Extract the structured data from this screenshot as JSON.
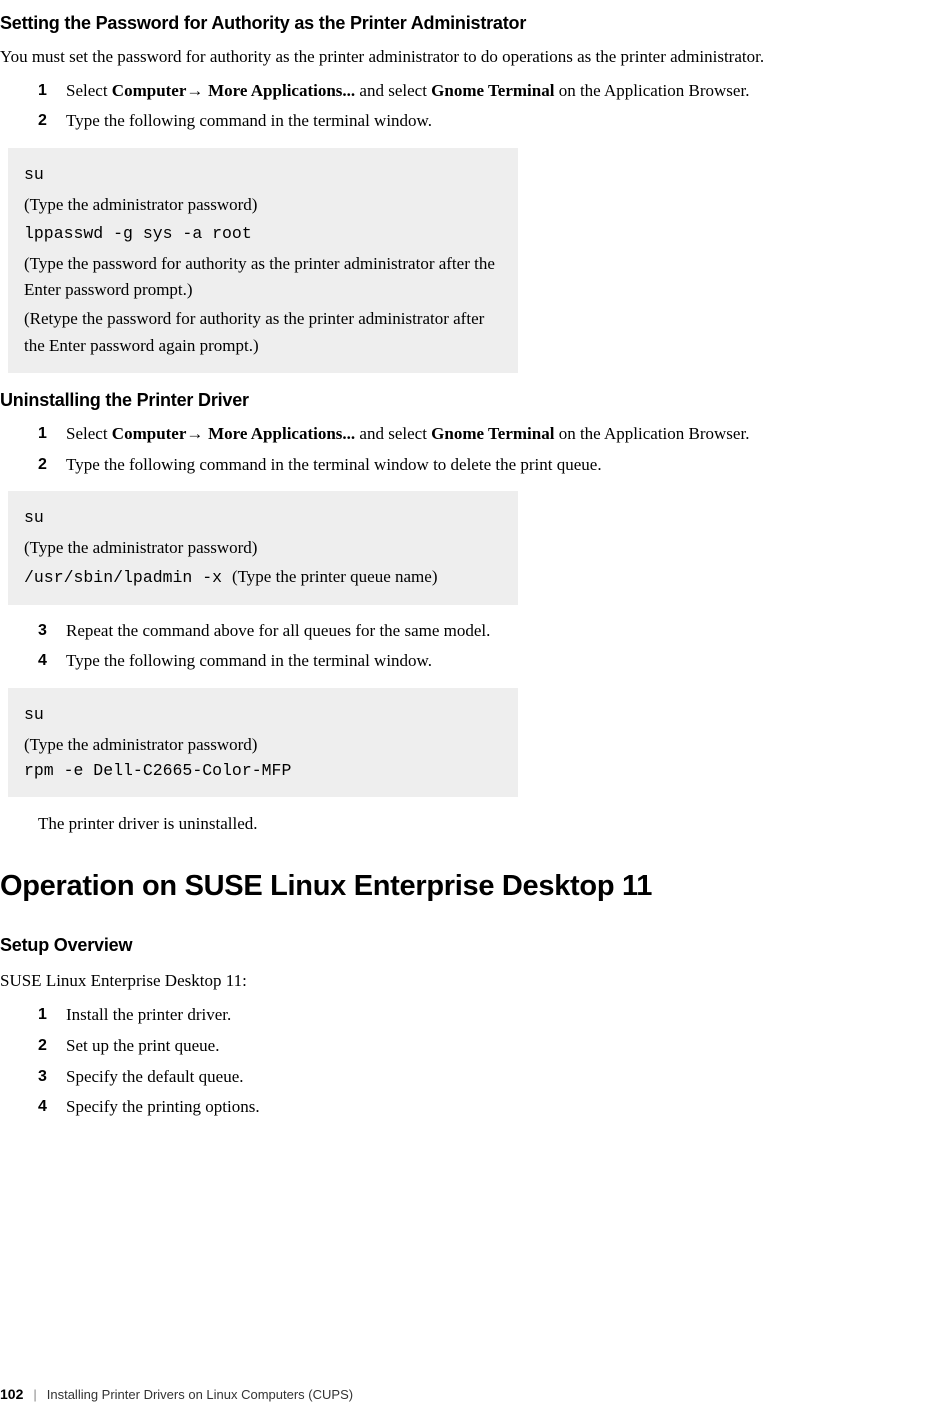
{
  "section1": {
    "title": "Setting the Password for Authority as the Printer Administrator",
    "intro": "You must set the password for authority as the printer administrator to do operations as the printer administrator.",
    "step1_num": "1",
    "step1_a": "Select ",
    "step1_b": "Computer",
    "step1_arrow": "→ ",
    "step1_c": "More Applications...",
    "step1_d": " and select ",
    "step1_e": "Gnome Terminal",
    "step1_f": " on the Application Browser.",
    "step2_num": "2",
    "step2": "Type the following command in the terminal window."
  },
  "codebox1": {
    "l1": "su",
    "l2": "(Type the administrator password)",
    "l3": "lppasswd -g sys -a root",
    "l4": "(Type the password for authority as the printer administrator after the Enter password prompt.)",
    "l5": "(Retype the password for authority as the printer administrator after the Enter password again prompt.)"
  },
  "section2": {
    "title": "Uninstalling the Printer Driver",
    "step1_num": "1",
    "step1_a": "Select ",
    "step1_b": "Computer",
    "step1_arrow": "→ ",
    "step1_c": "More Applications...",
    "step1_d": " and select ",
    "step1_e": "Gnome Terminal",
    "step1_f": " on the Application Browser.",
    "step2_num": "2",
    "step2": "Type the following command in the terminal window to delete the print queue."
  },
  "codebox2": {
    "l1": "su",
    "l2": "(Type the administrator password)",
    "l3_a": "/usr/sbin/lpadmin -x ",
    "l3_b": "(Type the printer queue name)"
  },
  "section2b": {
    "step3_num": "3",
    "step3": "Repeat the command above for all queues for the same model.",
    "step4_num": "4",
    "step4": "Type the following command in the terminal window."
  },
  "codebox3": {
    "l1": "su",
    "l2": "(Type the administrator password)",
    "l3": "rpm -e Dell-C2665-Color-MFP"
  },
  "section2c": {
    "result": "The printer driver is uninstalled."
  },
  "section3": {
    "h1": "Operation on SUSE Linux Enterprise Desktop 11",
    "h2": "Setup Overview",
    "intro": "SUSE Linux Enterprise Desktop 11:",
    "s1n": "1",
    "s1": "Install the printer driver.",
    "s2n": "2",
    "s2": "Set up the print queue.",
    "s3n": "3",
    "s3": "Specify the default queue.",
    "s4n": "4",
    "s4": "Specify the printing options."
  },
  "footer": {
    "page": "102",
    "sep": "|",
    "title": "Installing Printer Drivers on Linux Computers (CUPS)"
  }
}
